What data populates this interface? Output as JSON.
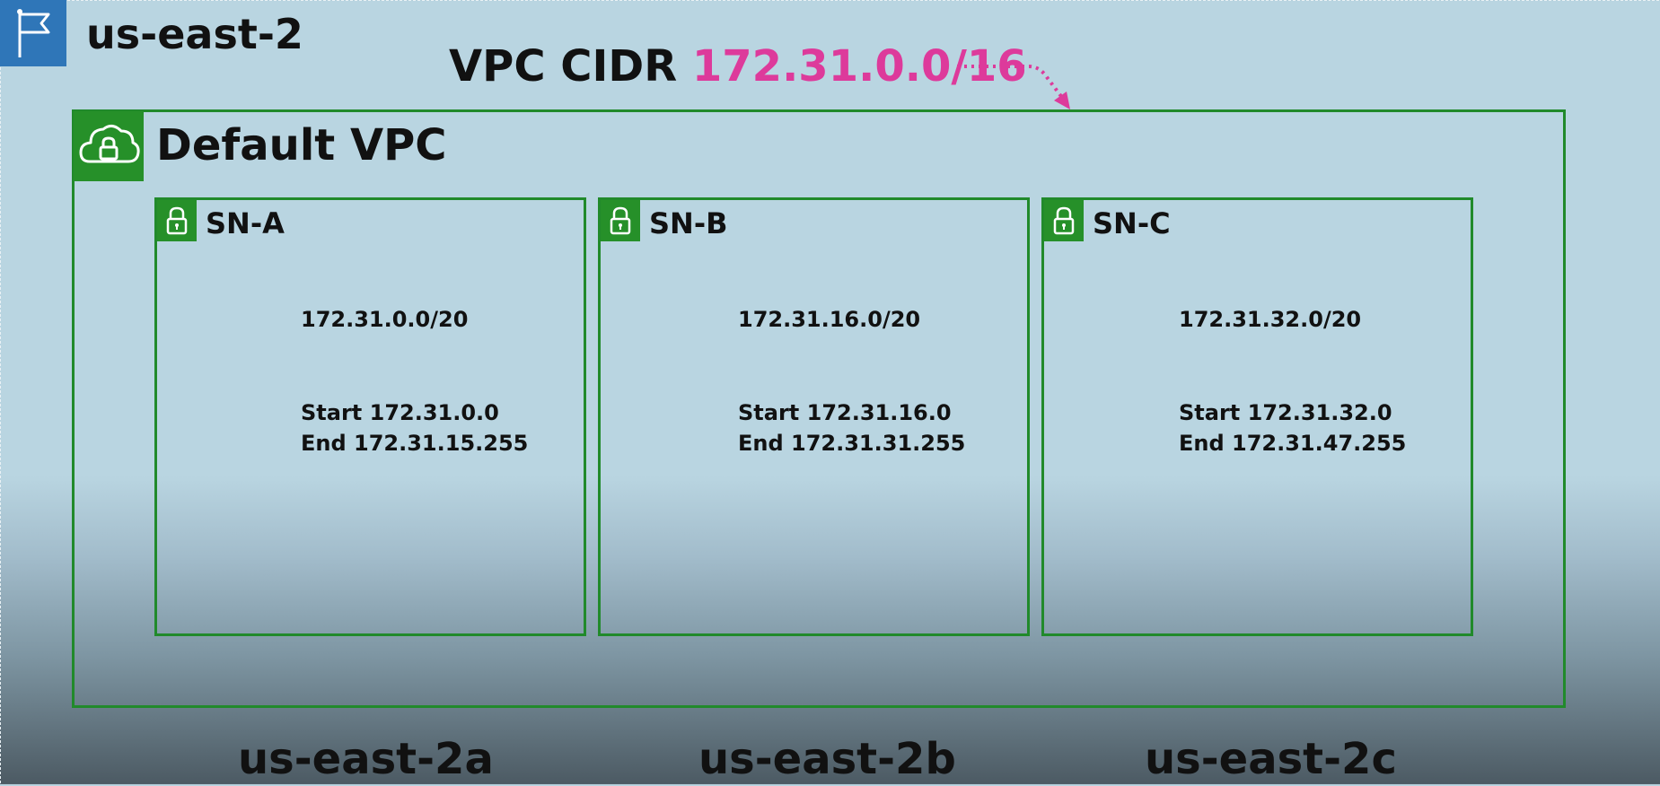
{
  "region": {
    "name": "us-east-2",
    "icon": "flag-icon",
    "color": "#2f76b8"
  },
  "vpc_cidr": {
    "label": "VPC CIDR",
    "value": "172.31.0.0/16",
    "value_color": "#dd3a9b"
  },
  "vpc": {
    "title": "Default VPC",
    "icon": "cloud-lock-icon",
    "border_color": "#218a2b"
  },
  "subnets": [
    {
      "name": "SN-A",
      "icon": "lock-icon",
      "cidr": "172.31.0.0/20",
      "start": "Start 172.31.0.0",
      "end": "End 172.31.15.255"
    },
    {
      "name": "SN-B",
      "icon": "lock-icon",
      "cidr": "172.31.16.0/20",
      "start": "Start 172.31.16.0",
      "end": "End 172.31.31.255"
    },
    {
      "name": "SN-C",
      "icon": "lock-icon",
      "cidr": "172.31.32.0/20",
      "start": "Start 172.31.32.0",
      "end": "End 172.31.47.255"
    }
  ],
  "availability_zones": [
    "us-east-2a",
    "us-east-2b",
    "us-east-2c"
  ]
}
